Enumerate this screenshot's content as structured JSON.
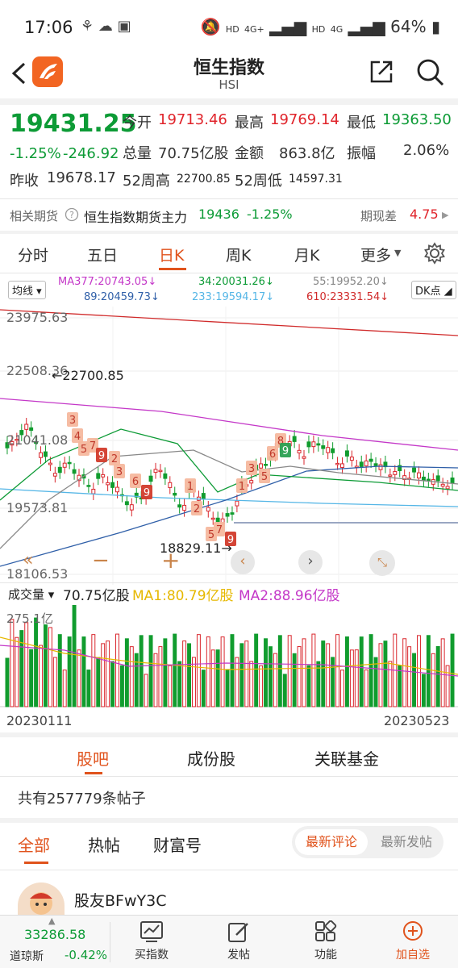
{
  "status": {
    "time": "17:06",
    "hd1": "HD",
    "net1": "4G+",
    "hd2": "HD",
    "net2": "4G",
    "battery": "64%"
  },
  "header": {
    "title": "恒生指数",
    "subtitle": "HSI"
  },
  "quote": {
    "price": "19431.25",
    "change_pct": "-1.25%",
    "change": "-246.92",
    "open_label": "今开",
    "open": "19713.46",
    "high_label": "最高",
    "high": "19769.14",
    "low_label": "最低",
    "low": "19363.50",
    "vol_label": "总量",
    "vol": "70.75亿股",
    "amt_label": "金额",
    "amt": "863.8亿",
    "amp_label": "振幅",
    "amp": "2.06%",
    "prev_label": "昨收",
    "prev": "19678.17",
    "w52h_label": "52周高",
    "w52h": "22700.85",
    "w52l_label": "52周低",
    "w52l": "14597.31"
  },
  "futures": {
    "label": "相关期货",
    "name": "恒生指数期货主力",
    "price": "19436",
    "pct": "-1.25%",
    "basis_label": "期现差",
    "basis": "4.75"
  },
  "tabs": [
    "分时",
    "五日",
    "日K",
    "周K",
    "月K",
    "更多"
  ],
  "chart_ctrl": {
    "ma_btn": "均线",
    "dk_btn": "DK点",
    "ma": [
      {
        "t": "MA377:20743.05↓",
        "c": "#c438c8"
      },
      {
        "t": "34:20031.26↓",
        "c": "#0d9b36"
      },
      {
        "t": "55:19952.20↓",
        "c": "#888888"
      },
      {
        "t": "89:20459.73↓",
        "c": "#2f5fa8"
      },
      {
        "t": "233:19594.17↓",
        "c": "#55b6e6"
      },
      {
        "t": "610:23331.54↓",
        "c": "#d02a2a"
      }
    ]
  },
  "chart_data": {
    "type": "candlestick",
    "y_ticks": [
      "23975.63",
      "22508.36",
      "21041.08",
      "19573.81",
      "18106.53"
    ],
    "high_annot": "22700.85",
    "low_annot": "18829.11",
    "x_start": "20230111",
    "x_end": "20230523",
    "dk_marks": [
      "1",
      "2",
      "3",
      "4",
      "5",
      "6",
      "7",
      "8",
      "9"
    ]
  },
  "volume": {
    "btn": "成交量",
    "total": "70.75亿股",
    "ma1": "MA1:80.79亿股",
    "ma2": "MA2:88.96亿股",
    "ymax": "275.1亿"
  },
  "subtabs": [
    "股吧",
    "成份股",
    "关联基金"
  ],
  "posts": {
    "count_text": "共有257779条帖子",
    "filters": [
      "全部",
      "热帖",
      "财富号"
    ],
    "sort": [
      "最新评论",
      "最新发帖"
    ],
    "user": "股友BFwY3C"
  },
  "bottom": {
    "index_name": "道琼斯",
    "index_value": "33286.58",
    "index_pct": "-0.42%",
    "nav": [
      "买指数",
      "发帖",
      "功能",
      "加自选"
    ]
  }
}
